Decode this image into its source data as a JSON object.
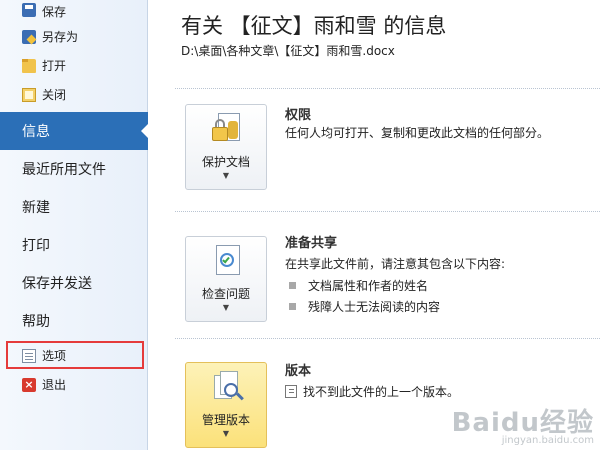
{
  "sidebar": {
    "top_items": [
      {
        "label": "保存",
        "icon": "save-icon"
      },
      {
        "label": "另存为",
        "icon": "save-as-icon"
      },
      {
        "label": "打开",
        "icon": "open-folder-icon"
      },
      {
        "label": "关闭",
        "icon": "close-folder-icon"
      }
    ],
    "selected": "信息",
    "large_items": [
      "最近所用文件",
      "新建",
      "打印",
      "保存并发送",
      "帮助"
    ],
    "bottom_items": [
      {
        "label": "选项",
        "icon": "options-icon"
      },
      {
        "label": "退出",
        "icon": "exit-icon"
      }
    ],
    "accent_color": "#2b6fb7",
    "highlight_color": "#e53b3b"
  },
  "main": {
    "title": "有关 【征文】雨和雪 的信息",
    "path": "D:\\桌面\\各种文章\\【征文】雨和雪.docx",
    "sections": [
      {
        "button_label": "保护文档",
        "button_icon": "lock-document-icon",
        "title": "权限",
        "text": "任何人均可打开、复制和更改此文档的任何部分。"
      },
      {
        "button_label": "检查问题",
        "button_icon": "check-document-icon",
        "title": "准备共享",
        "text": "在共享此文件前，请注意其包含以下内容:",
        "bullets": [
          "文档属性和作者的姓名",
          "残障人士无法阅读的内容"
        ]
      },
      {
        "button_label": "管理版本",
        "button_icon": "manage-versions-icon",
        "title": "版本",
        "text": "找不到此文件的上一个版本。"
      }
    ]
  },
  "watermark": {
    "main": "Baidu经验",
    "sub": "jingyan.baidu.com"
  }
}
